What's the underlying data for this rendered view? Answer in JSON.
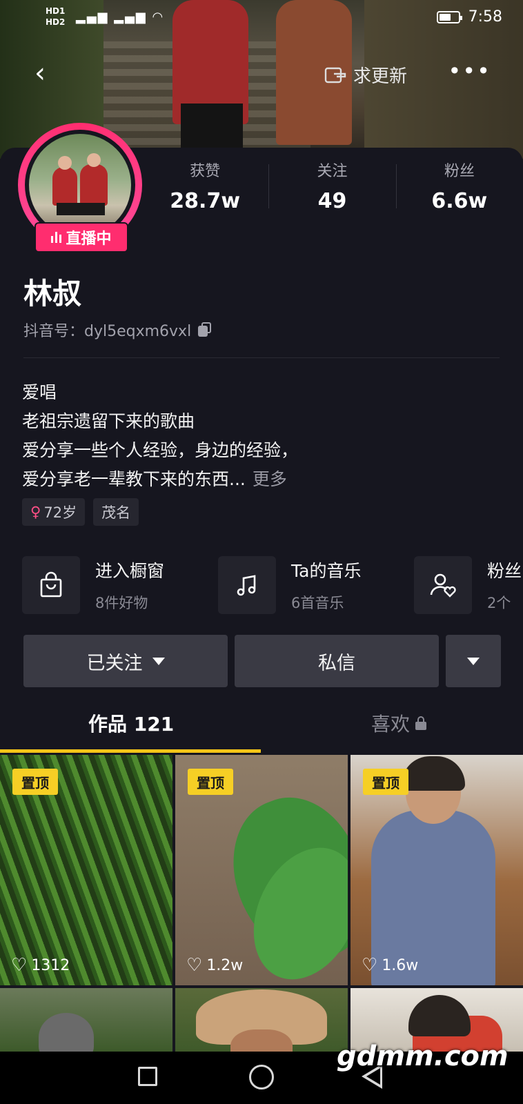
{
  "status_bar": {
    "left_labels": [
      "HD1",
      "HD2"
    ],
    "network": "5G 4G",
    "time": "7:58"
  },
  "top_nav": {
    "back_icon": "chevron-left-icon",
    "update_label": "求更新",
    "more_icon": "more-dots-icon"
  },
  "profile": {
    "live_label": "直播中",
    "stats": [
      {
        "label": "获赞",
        "value": "28.7w"
      },
      {
        "label": "关注",
        "value": "49"
      },
      {
        "label": "粉丝",
        "value": "6.6w"
      }
    ],
    "name": "林叔",
    "douyin_id": "抖音号：dyl5eqxm6vxl",
    "bio_lines": [
      "爱唱",
      "老祖宗遗留下来的歌曲",
      "爱分享一些个人经验，身边的经验，",
      "爱分享老一辈教下来的东西..."
    ],
    "bio_more": "更多",
    "tags": [
      {
        "icon": "female-icon",
        "label": "72岁"
      },
      {
        "label": "茂名"
      }
    ]
  },
  "features": [
    {
      "icon": "shopping-bag-icon",
      "title": "进入橱窗",
      "subtitle": "8件好物"
    },
    {
      "icon": "music-note-icon",
      "title": "Ta的音乐",
      "subtitle": "6首音乐"
    },
    {
      "icon": "fan-group-icon",
      "title": "粉丝",
      "subtitle": "2个"
    }
  ],
  "buttons": {
    "followed": "已关注",
    "message": "私信"
  },
  "tabs": {
    "works": "作品 121",
    "likes": "喜欢"
  },
  "videos": [
    {
      "pinned": "置顶",
      "likes": "1312"
    },
    {
      "pinned": "置顶",
      "likes": "1.2w"
    },
    {
      "pinned": "置顶",
      "likes": "1.6w"
    },
    {
      "pinned": "",
      "likes": ""
    },
    {
      "pinned": "",
      "likes": ""
    },
    {
      "pinned": "",
      "likes": ""
    }
  ],
  "watermark": "gdmm.com",
  "colors": {
    "background": "#16161f",
    "live_pink": "#ff2d6f",
    "tab_underline": "#f5c518",
    "pin_badge": "#f6cf25"
  }
}
